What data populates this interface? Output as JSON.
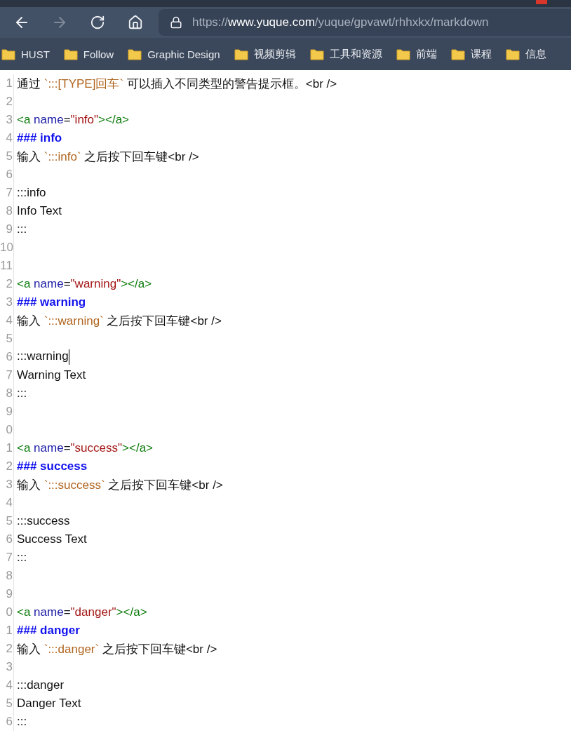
{
  "browser": {
    "nav_buttons": [
      {
        "kind": "back",
        "disabled": false
      },
      {
        "kind": "forward",
        "disabled": true
      },
      {
        "kind": "reload",
        "disabled": false
      },
      {
        "kind": "home",
        "disabled": false
      }
    ],
    "url": {
      "scheme": "https://",
      "host": "www.yuque.com",
      "path": "/yuque/gpvawt/rhhxkx/markdown"
    },
    "bookmarks": [
      "HUST",
      "Follow",
      "Graphic Design",
      "视频剪辑",
      "工具和资源",
      "前端",
      "课程",
      "信息"
    ]
  },
  "editor": {
    "lines": [
      {
        "number": "1",
        "cursor": false,
        "tokens": [
          {
            "kind": "text",
            "text": "通过 "
          },
          {
            "kind": "code",
            "text": "`:::[TYPE]回车`"
          },
          {
            "kind": "text",
            "text": " 可以插入不同类型的警告提示框。<br />"
          }
        ]
      },
      {
        "number": "2",
        "cursor": false
      },
      {
        "number": "3",
        "cursor": false,
        "tokens": [
          {
            "kind": "tag",
            "text": "<a"
          },
          {
            "kind": "attr",
            "text": " name"
          },
          {
            "kind": "text",
            "text": "="
          },
          {
            "kind": "string",
            "text": "\"info\""
          },
          {
            "kind": "tag",
            "text": "></a>"
          }
        ]
      },
      {
        "number": "4",
        "cursor": false,
        "tokens": [
          {
            "kind": "heading",
            "text": "### info"
          }
        ]
      },
      {
        "number": "5",
        "cursor": false,
        "tokens": [
          {
            "kind": "text",
            "text": "输入 "
          },
          {
            "kind": "code",
            "text": "`:::info`"
          },
          {
            "kind": "text",
            "text": " 之后按下回车键<br />"
          }
        ]
      },
      {
        "number": "6",
        "cursor": false
      },
      {
        "number": "7",
        "cursor": false,
        "tokens": [
          {
            "kind": "text",
            "text": ":::info"
          }
        ]
      },
      {
        "number": "8",
        "cursor": false,
        "tokens": [
          {
            "kind": "text",
            "text": "Info Text"
          }
        ]
      },
      {
        "number": "9",
        "cursor": false,
        "tokens": [
          {
            "kind": "text",
            "text": ":::"
          }
        ]
      },
      {
        "number": "10",
        "cursor": false
      },
      {
        "number": "11",
        "cursor": false
      },
      {
        "number": "2",
        "cursor": false,
        "tokens": [
          {
            "kind": "tag",
            "text": "<a"
          },
          {
            "kind": "attr",
            "text": " name"
          },
          {
            "kind": "text",
            "text": "="
          },
          {
            "kind": "string",
            "text": "\"warning\""
          },
          {
            "kind": "tag",
            "text": "></a>"
          }
        ]
      },
      {
        "number": "3",
        "cursor": false,
        "tokens": [
          {
            "kind": "heading",
            "text": "### warning"
          }
        ]
      },
      {
        "number": "4",
        "cursor": false,
        "tokens": [
          {
            "kind": "text",
            "text": "输入 "
          },
          {
            "kind": "code",
            "text": "`:::warning`"
          },
          {
            "kind": "text",
            "text": " 之后按下回车键<br />"
          }
        ]
      },
      {
        "number": "5",
        "cursor": false
      },
      {
        "number": "6",
        "cursor": true,
        "tokens": [
          {
            "kind": "text",
            "text": ":::warning"
          }
        ]
      },
      {
        "number": "7",
        "cursor": false,
        "tokens": [
          {
            "kind": "text",
            "text": "Warning Text"
          }
        ]
      },
      {
        "number": "8",
        "cursor": false,
        "tokens": [
          {
            "kind": "text",
            "text": ":::"
          }
        ]
      },
      {
        "number": "9",
        "cursor": false
      },
      {
        "number": "0",
        "cursor": false
      },
      {
        "number": "1",
        "cursor": false,
        "tokens": [
          {
            "kind": "tag",
            "text": "<a"
          },
          {
            "kind": "attr",
            "text": " name"
          },
          {
            "kind": "text",
            "text": "="
          },
          {
            "kind": "string",
            "text": "\"success\""
          },
          {
            "kind": "tag",
            "text": "></a>"
          }
        ]
      },
      {
        "number": "2",
        "cursor": false,
        "tokens": [
          {
            "kind": "heading",
            "text": "### success"
          }
        ]
      },
      {
        "number": "3",
        "cursor": false,
        "tokens": [
          {
            "kind": "text",
            "text": "输入 "
          },
          {
            "kind": "code",
            "text": "`:::success`"
          },
          {
            "kind": "text",
            "text": " 之后按下回车键<br />"
          }
        ]
      },
      {
        "number": "4",
        "cursor": false
      },
      {
        "number": "5",
        "cursor": false,
        "tokens": [
          {
            "kind": "text",
            "text": ":::success"
          }
        ]
      },
      {
        "number": "6",
        "cursor": false,
        "tokens": [
          {
            "kind": "text",
            "text": "Success Text"
          }
        ]
      },
      {
        "number": "7",
        "cursor": false,
        "tokens": [
          {
            "kind": "text",
            "text": ":::"
          }
        ]
      },
      {
        "number": "8",
        "cursor": false
      },
      {
        "number": "9",
        "cursor": false
      },
      {
        "number": "0",
        "cursor": false,
        "tokens": [
          {
            "kind": "tag",
            "text": "<a"
          },
          {
            "kind": "attr",
            "text": " name"
          },
          {
            "kind": "text",
            "text": "="
          },
          {
            "kind": "string",
            "text": "\"danger\""
          },
          {
            "kind": "tag",
            "text": "></a>"
          }
        ]
      },
      {
        "number": "1",
        "cursor": false,
        "tokens": [
          {
            "kind": "heading",
            "text": "### danger"
          }
        ]
      },
      {
        "number": "2",
        "cursor": false,
        "tokens": [
          {
            "kind": "text",
            "text": "输入 "
          },
          {
            "kind": "code",
            "text": "`:::danger`"
          },
          {
            "kind": "text",
            "text": " 之后按下回车键<br />"
          }
        ]
      },
      {
        "number": "3",
        "cursor": false
      },
      {
        "number": "4",
        "cursor": false,
        "tokens": [
          {
            "kind": "text",
            "text": ":::danger"
          }
        ]
      },
      {
        "number": "5",
        "cursor": false,
        "tokens": [
          {
            "kind": "text",
            "text": "Danger Text"
          }
        ]
      },
      {
        "number": "6",
        "cursor": false,
        "tokens": [
          {
            "kind": "text",
            "text": ":::"
          }
        ]
      }
    ]
  }
}
